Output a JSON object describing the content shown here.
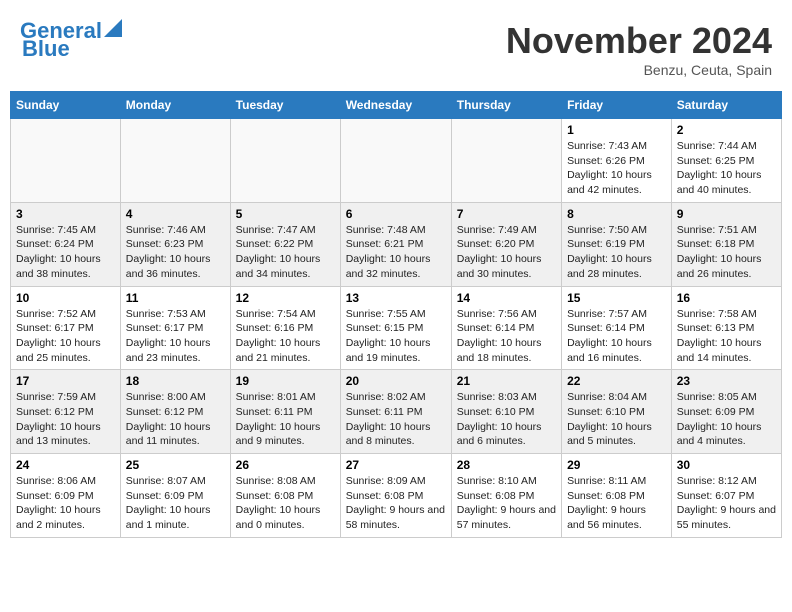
{
  "header": {
    "logo_line1": "General",
    "logo_line2": "Blue",
    "month": "November 2024",
    "location": "Benzu, Ceuta, Spain"
  },
  "weekdays": [
    "Sunday",
    "Monday",
    "Tuesday",
    "Wednesday",
    "Thursday",
    "Friday",
    "Saturday"
  ],
  "weeks": [
    [
      {
        "day": "",
        "info": ""
      },
      {
        "day": "",
        "info": ""
      },
      {
        "day": "",
        "info": ""
      },
      {
        "day": "",
        "info": ""
      },
      {
        "day": "",
        "info": ""
      },
      {
        "day": "1",
        "info": "Sunrise: 7:43 AM\nSunset: 6:26 PM\nDaylight: 10 hours and 42 minutes."
      },
      {
        "day": "2",
        "info": "Sunrise: 7:44 AM\nSunset: 6:25 PM\nDaylight: 10 hours and 40 minutes."
      }
    ],
    [
      {
        "day": "3",
        "info": "Sunrise: 7:45 AM\nSunset: 6:24 PM\nDaylight: 10 hours and 38 minutes."
      },
      {
        "day": "4",
        "info": "Sunrise: 7:46 AM\nSunset: 6:23 PM\nDaylight: 10 hours and 36 minutes."
      },
      {
        "day": "5",
        "info": "Sunrise: 7:47 AM\nSunset: 6:22 PM\nDaylight: 10 hours and 34 minutes."
      },
      {
        "day": "6",
        "info": "Sunrise: 7:48 AM\nSunset: 6:21 PM\nDaylight: 10 hours and 32 minutes."
      },
      {
        "day": "7",
        "info": "Sunrise: 7:49 AM\nSunset: 6:20 PM\nDaylight: 10 hours and 30 minutes."
      },
      {
        "day": "8",
        "info": "Sunrise: 7:50 AM\nSunset: 6:19 PM\nDaylight: 10 hours and 28 minutes."
      },
      {
        "day": "9",
        "info": "Sunrise: 7:51 AM\nSunset: 6:18 PM\nDaylight: 10 hours and 26 minutes."
      }
    ],
    [
      {
        "day": "10",
        "info": "Sunrise: 7:52 AM\nSunset: 6:17 PM\nDaylight: 10 hours and 25 minutes."
      },
      {
        "day": "11",
        "info": "Sunrise: 7:53 AM\nSunset: 6:17 PM\nDaylight: 10 hours and 23 minutes."
      },
      {
        "day": "12",
        "info": "Sunrise: 7:54 AM\nSunset: 6:16 PM\nDaylight: 10 hours and 21 minutes."
      },
      {
        "day": "13",
        "info": "Sunrise: 7:55 AM\nSunset: 6:15 PM\nDaylight: 10 hours and 19 minutes."
      },
      {
        "day": "14",
        "info": "Sunrise: 7:56 AM\nSunset: 6:14 PM\nDaylight: 10 hours and 18 minutes."
      },
      {
        "day": "15",
        "info": "Sunrise: 7:57 AM\nSunset: 6:14 PM\nDaylight: 10 hours and 16 minutes."
      },
      {
        "day": "16",
        "info": "Sunrise: 7:58 AM\nSunset: 6:13 PM\nDaylight: 10 hours and 14 minutes."
      }
    ],
    [
      {
        "day": "17",
        "info": "Sunrise: 7:59 AM\nSunset: 6:12 PM\nDaylight: 10 hours and 13 minutes."
      },
      {
        "day": "18",
        "info": "Sunrise: 8:00 AM\nSunset: 6:12 PM\nDaylight: 10 hours and 11 minutes."
      },
      {
        "day": "19",
        "info": "Sunrise: 8:01 AM\nSunset: 6:11 PM\nDaylight: 10 hours and 9 minutes."
      },
      {
        "day": "20",
        "info": "Sunrise: 8:02 AM\nSunset: 6:11 PM\nDaylight: 10 hours and 8 minutes."
      },
      {
        "day": "21",
        "info": "Sunrise: 8:03 AM\nSunset: 6:10 PM\nDaylight: 10 hours and 6 minutes."
      },
      {
        "day": "22",
        "info": "Sunrise: 8:04 AM\nSunset: 6:10 PM\nDaylight: 10 hours and 5 minutes."
      },
      {
        "day": "23",
        "info": "Sunrise: 8:05 AM\nSunset: 6:09 PM\nDaylight: 10 hours and 4 minutes."
      }
    ],
    [
      {
        "day": "24",
        "info": "Sunrise: 8:06 AM\nSunset: 6:09 PM\nDaylight: 10 hours and 2 minutes."
      },
      {
        "day": "25",
        "info": "Sunrise: 8:07 AM\nSunset: 6:09 PM\nDaylight: 10 hours and 1 minute."
      },
      {
        "day": "26",
        "info": "Sunrise: 8:08 AM\nSunset: 6:08 PM\nDaylight: 10 hours and 0 minutes."
      },
      {
        "day": "27",
        "info": "Sunrise: 8:09 AM\nSunset: 6:08 PM\nDaylight: 9 hours and 58 minutes."
      },
      {
        "day": "28",
        "info": "Sunrise: 8:10 AM\nSunset: 6:08 PM\nDaylight: 9 hours and 57 minutes."
      },
      {
        "day": "29",
        "info": "Sunrise: 8:11 AM\nSunset: 6:08 PM\nDaylight: 9 hours and 56 minutes."
      },
      {
        "day": "30",
        "info": "Sunrise: 8:12 AM\nSunset: 6:07 PM\nDaylight: 9 hours and 55 minutes."
      }
    ]
  ]
}
